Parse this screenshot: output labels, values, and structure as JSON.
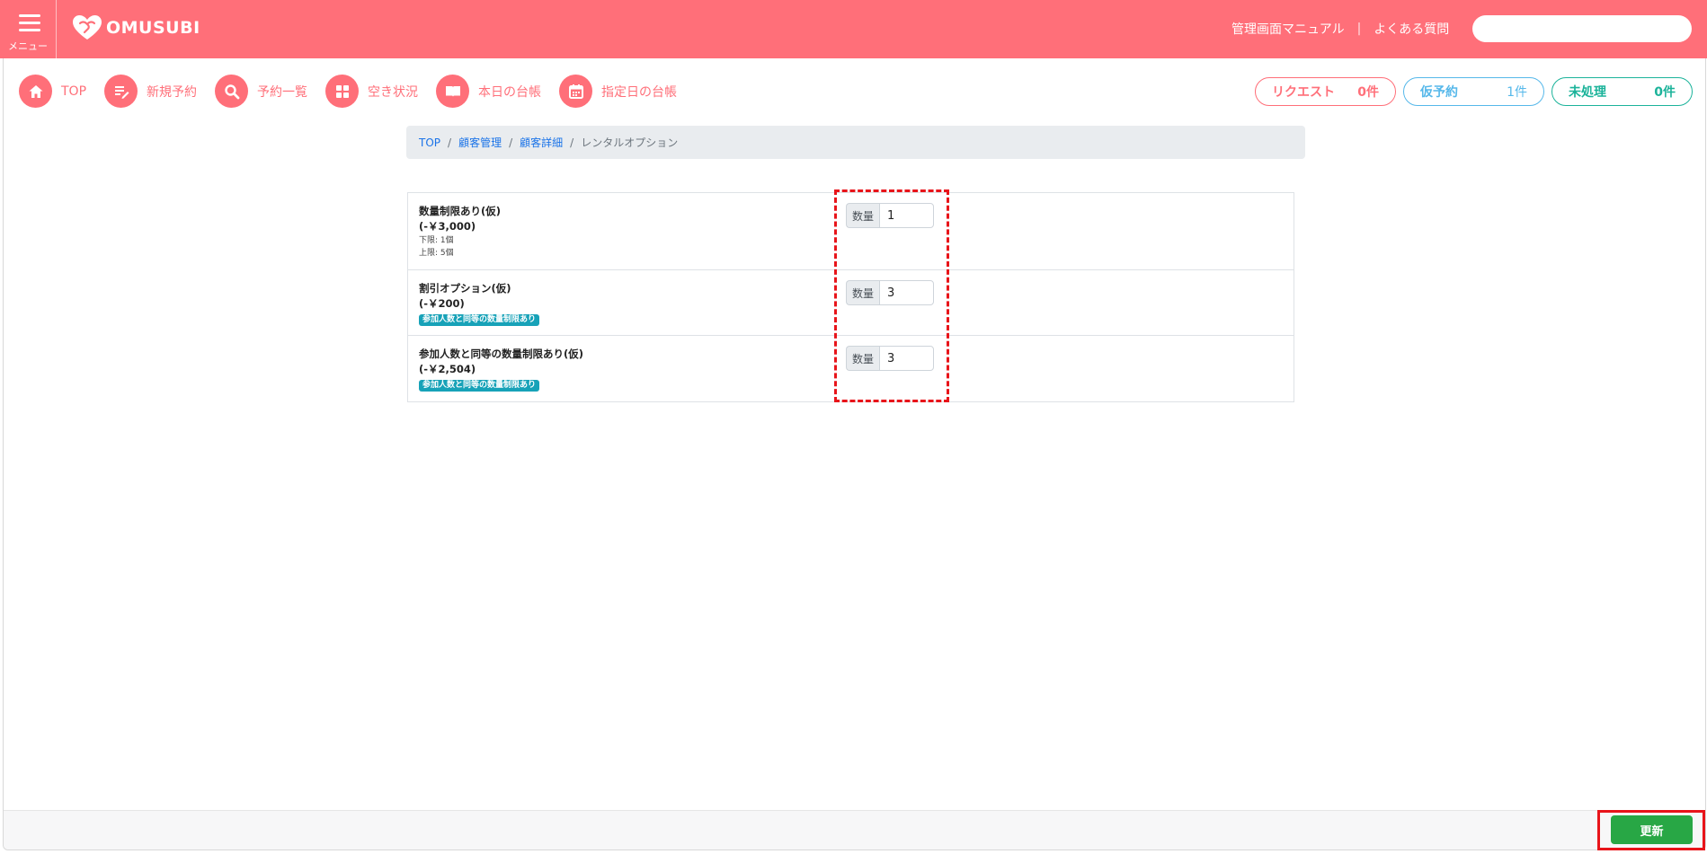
{
  "header": {
    "menu_label": "メニュー",
    "logo_text": "OMUSUBI",
    "links": [
      "管理画面マニュアル",
      "よくある質問"
    ],
    "link_separator": "|",
    "search_placeholder": "",
    "color": "#ff6f79"
  },
  "nav": {
    "items": [
      {
        "label": "TOP",
        "icon": "home-icon"
      },
      {
        "label": "新規予約",
        "icon": "edit-icon"
      },
      {
        "label": "予約一覧",
        "icon": "search-icon"
      },
      {
        "label": "空き状況",
        "icon": "grid-icon"
      },
      {
        "label": "本日の台帳",
        "icon": "book-icon"
      },
      {
        "label": "指定日の台帳",
        "icon": "calendar-icon"
      }
    ],
    "status": {
      "request": {
        "label": "リクエスト",
        "count": "0件",
        "color": "#ff6f79"
      },
      "provisional": {
        "label": "仮予約",
        "count": "1件",
        "color": "#56b8ea"
      },
      "unprocessed": {
        "label": "未処理",
        "count": "0件",
        "color": "#1bb39a"
      }
    }
  },
  "breadcrumb": {
    "items": [
      "TOP",
      "顧客管理",
      "顧客詳細"
    ],
    "current": "レンタルオプション",
    "separator": "/"
  },
  "options": [
    {
      "name": "数量制限あり(仮)",
      "price": "(-￥3,000)",
      "lower_limit": "下限: 1個",
      "upper_limit": "上限: 5個",
      "qty_label": "数量",
      "qty_value": "1"
    },
    {
      "name": "割引オプション(仮)",
      "price": "(-￥200)",
      "badge": "参加人数と同等の数量制限あり",
      "qty_label": "数量",
      "qty_value": "3"
    },
    {
      "name": "参加人数と同等の数量制限あり(仮)",
      "price": "(-￥2,504)",
      "badge": "参加人数と同等の数量制限あり",
      "qty_label": "数量",
      "qty_value": "3"
    }
  ],
  "footer": {
    "update_label": "更新",
    "update_color": "#28a745"
  },
  "annotation_color": "#e8141a"
}
